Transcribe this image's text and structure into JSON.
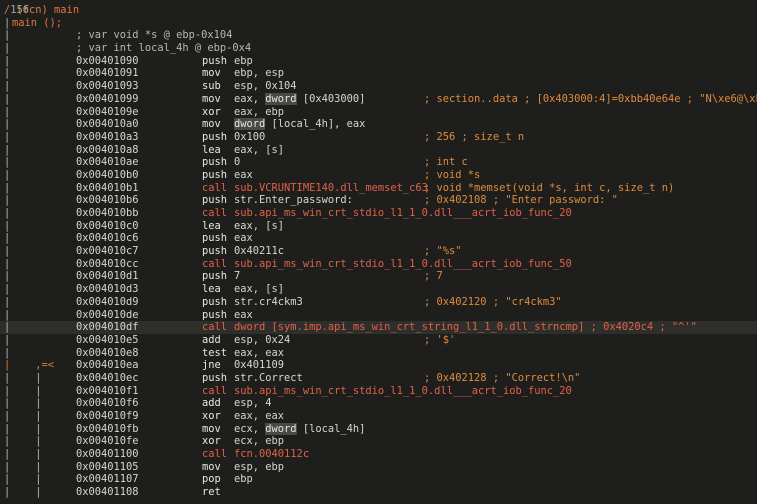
{
  "header": {
    "prefix": "/ (fcn) main",
    "size": "156",
    "func": "main ();"
  },
  "vars": [
    "; var void *s @ ebp-0x104",
    "; var int local_4h @ ebp-0x4"
  ],
  "rows": [
    {
      "g": "|",
      "a": "0x00401090",
      "m": "push",
      "o": "ebp",
      "c": ""
    },
    {
      "g": "|",
      "a": "0x00401091",
      "m": "mov",
      "o": "ebp, esp",
      "c": ""
    },
    {
      "g": "|",
      "a": "0x00401093",
      "m": "sub",
      "o": "esp, 0x104",
      "c": ""
    },
    {
      "g": "|",
      "a": "0x00401099",
      "m": "mov",
      "o": "eax, dword [0x403000]",
      "c": "; section..data ; [0x403000:4]=0xbb40e64e ; \"N\\xe6@\\xbb\\"
    },
    {
      "g": "|",
      "a": "0x0040109e",
      "m": "xor",
      "o": "eax, ebp",
      "c": ""
    },
    {
      "g": "|",
      "a": "0x004010a0",
      "m": "mov",
      "o": "dword [local_4h], eax",
      "c": ""
    },
    {
      "g": "|",
      "a": "0x004010a3",
      "m": "push",
      "o": "0x100",
      "c": "; 256 ; size_t n"
    },
    {
      "g": "|",
      "a": "0x004010a8",
      "m": "lea",
      "o": "eax, [s]",
      "c": ""
    },
    {
      "g": "|",
      "a": "0x004010ae",
      "m": "push",
      "o": "0",
      "c": "; int c"
    },
    {
      "g": "|",
      "a": "0x004010b0",
      "m": "push",
      "o": "eax",
      "c": "; void *s"
    },
    {
      "g": "|",
      "a": "0x004010b1",
      "m": "call",
      "o": "sub.VCRUNTIME140.dll_memset_c63",
      "c": "; void *memset(void *s, int c, size_t n)"
    },
    {
      "g": "|",
      "a": "0x004010b6",
      "m": "push",
      "o": "str.Enter_password:",
      "c": "; 0x402108 ; \"Enter password: \""
    },
    {
      "g": "|",
      "a": "0x004010bb",
      "m": "call",
      "o": "sub.api_ms_win_crt_stdio_l1_1_0.dll___acrt_iob_func_20",
      "c": ""
    },
    {
      "g": "|",
      "a": "0x004010c0",
      "m": "lea",
      "o": "eax, [s]",
      "c": ""
    },
    {
      "g": "|",
      "a": "0x004010c6",
      "m": "push",
      "o": "eax",
      "c": ""
    },
    {
      "g": "|",
      "a": "0x004010c7",
      "m": "push",
      "o": "0x40211c",
      "c": "; \"%s\""
    },
    {
      "g": "|",
      "a": "0x004010cc",
      "m": "call",
      "o": "sub.api_ms_win_crt_stdio_l1_1_0.dll___acrt_iob_func_50",
      "c": ""
    },
    {
      "g": "|",
      "a": "0x004010d1",
      "m": "push",
      "o": "7",
      "c": "; 7"
    },
    {
      "g": "|",
      "a": "0x004010d3",
      "m": "lea",
      "o": "eax, [s]",
      "c": ""
    },
    {
      "g": "|",
      "a": "0x004010d9",
      "m": "push",
      "o": "str.cr4ckm3",
      "c": "; 0x402120 ; \"cr4ckm3\""
    },
    {
      "g": "|",
      "a": "0x004010de",
      "m": "push",
      "o": "eax",
      "c": ""
    },
    {
      "g": "|",
      "a": "0x004010df",
      "m": "call",
      "o": "dword [sym.imp.api_ms_win_crt_string_l1_1_0.dll_strncmp] ; 0x4020c4 ; \"^'\"",
      "c": "",
      "hl": true
    },
    {
      "g": "|",
      "a": "0x004010e5",
      "m": "add",
      "o": "esp, 0x24",
      "c": "; '$'"
    },
    {
      "g": "|",
      "a": "0x004010e8",
      "m": "test",
      "o": "eax, eax",
      "c": ""
    },
    {
      "g": "|    ,=<",
      "a": "0x004010ea",
      "m": "jne",
      "o": "0x401109",
      "c": ""
    },
    {
      "g": "|    |",
      "a": "0x004010ec",
      "m": "push",
      "o": "str.Correct",
      "c": "; 0x402128 ; \"Correct!\\n\""
    },
    {
      "g": "|    |",
      "a": "0x004010f1",
      "m": "call",
      "o": "sub.api_ms_win_crt_stdio_l1_1_0.dll___acrt_iob_func_20",
      "c": ""
    },
    {
      "g": "|    |",
      "a": "0x004010f6",
      "m": "add",
      "o": "esp, 4",
      "c": ""
    },
    {
      "g": "|    |",
      "a": "0x004010f9",
      "m": "xor",
      "o": "eax, eax",
      "c": ""
    },
    {
      "g": "|    |",
      "a": "0x004010fb",
      "m": "mov",
      "o": "ecx, dword [local_4h]",
      "c": ""
    },
    {
      "g": "|    |",
      "a": "0x004010fe",
      "m": "xor",
      "o": "ecx, ebp",
      "c": ""
    },
    {
      "g": "|    |",
      "a": "0x00401100",
      "m": "call",
      "o": "fcn.0040112c",
      "c": ""
    },
    {
      "g": "|    |",
      "a": "0x00401105",
      "m": "mov",
      "o": "esp, ebp",
      "c": ""
    },
    {
      "g": "|    |",
      "a": "0x00401107",
      "m": "pop",
      "o": "ebp",
      "c": ""
    },
    {
      "g": "|    |",
      "a": "0x00401108",
      "m": "ret",
      "o": "",
      "c": ""
    }
  ],
  "colors": {
    "background": "#1e1f1c",
    "call": "#e0604a",
    "comment": "#e08a3c",
    "highlight": "#2e2f2b"
  }
}
